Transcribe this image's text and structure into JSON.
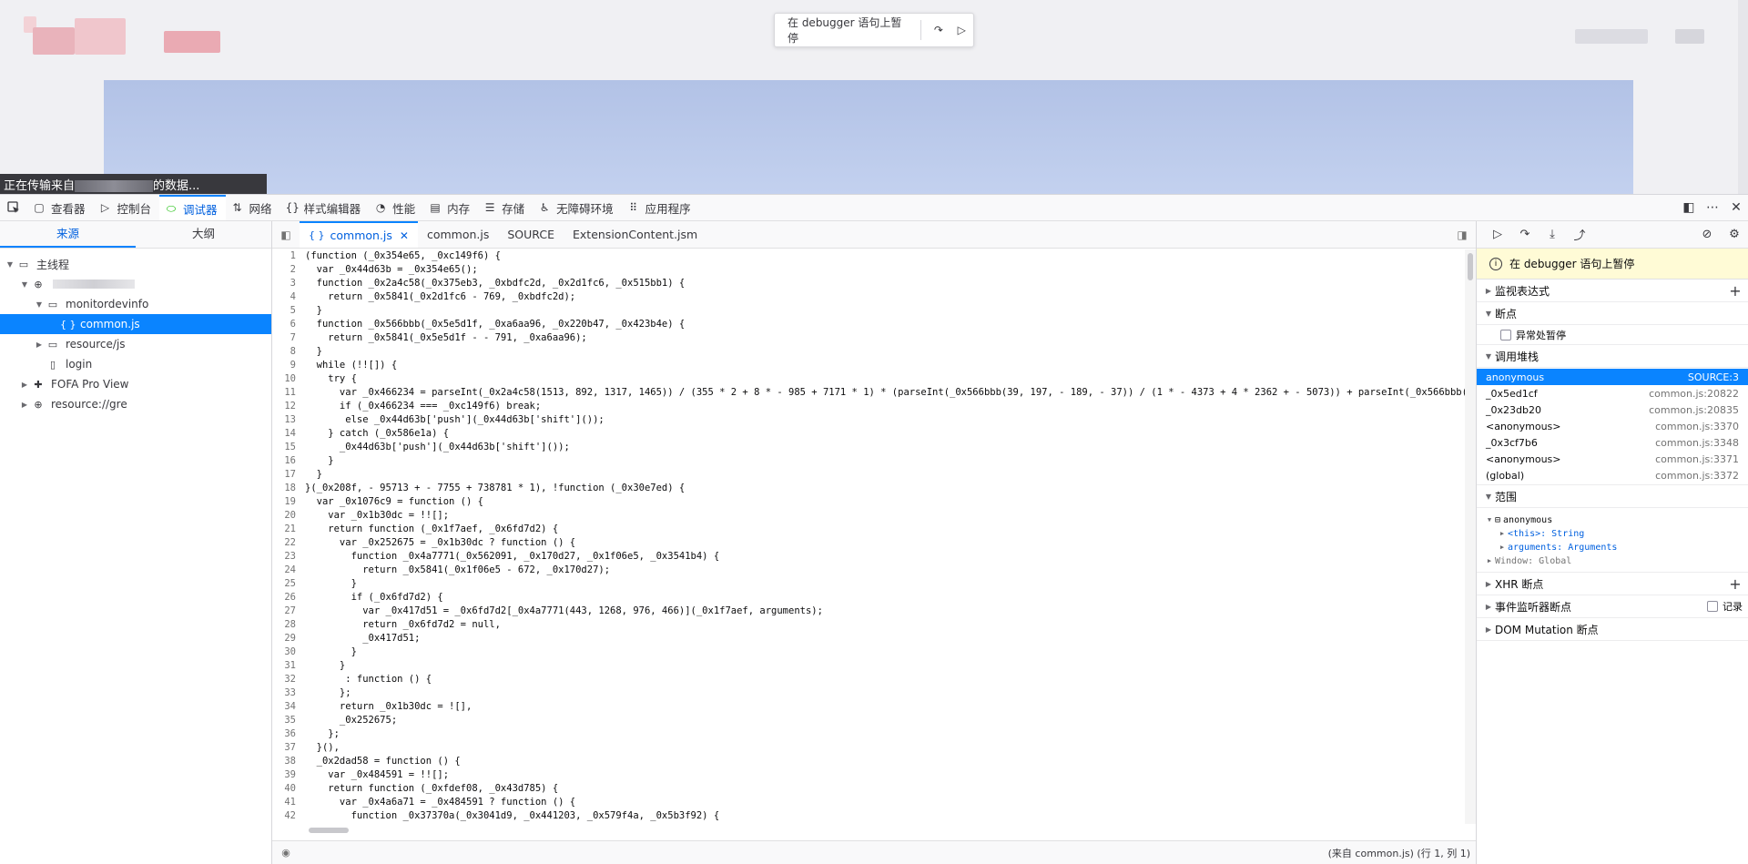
{
  "page": {
    "pause_text": "在 debugger 语句上暂停",
    "loading_prefix": "正在传输来自",
    "loading_suffix": "的数据..."
  },
  "toolbar": {
    "items": [
      {
        "label": "查看器",
        "icon": "inspector-icon"
      },
      {
        "label": "控制台",
        "icon": "console-icon"
      },
      {
        "label": "调试器",
        "icon": "debugger-icon"
      },
      {
        "label": "网络",
        "icon": "network-icon"
      },
      {
        "label": "样式编辑器",
        "icon": "style-editor-icon"
      },
      {
        "label": "性能",
        "icon": "performance-icon"
      },
      {
        "label": "内存",
        "icon": "memory-icon"
      },
      {
        "label": "存储",
        "icon": "storage-icon"
      },
      {
        "label": "无障碍环境",
        "icon": "accessibility-icon"
      },
      {
        "label": "应用程序",
        "icon": "application-icon"
      }
    ],
    "active": "调试器"
  },
  "left": {
    "tabs": [
      "来源",
      "大纲"
    ],
    "tree": {
      "main_thread": "主线程",
      "domain_icon": "globe-icon",
      "folder1": "monitordevinfo",
      "file_selected": "common.js",
      "folder2": "resource/js",
      "file2": "login",
      "ext": "FOFA Pro View",
      "resource": "resource://gre"
    }
  },
  "editor": {
    "tabs": [
      "common.js",
      "common.js",
      "SOURCE",
      "ExtensionContent.jsm"
    ],
    "lines": [
      "(function (_0x354e65, _0xc149f6) {",
      "  var _0x44d63b = _0x354e65();",
      "  function _0x2a4c58(_0x375eb3, _0xbdfc2d, _0x2d1fc6, _0x515bb1) {",
      "    return _0x5841(_0x2d1fc6 - 769, _0xbdfc2d);",
      "  }",
      "  function _0x566bbb(_0x5e5d1f, _0xa6aa96, _0x220b47, _0x423b4e) {",
      "    return _0x5841(_0x5e5d1f - - 791, _0xa6aa96);",
      "  }",
      "  while (!![]) {",
      "    try {",
      "      var _0x466234 = parseInt(_0x2a4c58(1513, 892, 1317, 1465)) / (355 * 2 + 8 * - 985 + 7171 * 1) * (parseInt(_0x566bbb(39, 197, - 189, - 37)) / (1 * - 4373 + 4 * 2362 + - 5073)) + parseInt(_0x566bbb( - 203, - 505, - 399, - 662)",
      "      if (_0x466234 === _0xc149f6) break;",
      "       else _0x44d63b['push'](_0x44d63b['shift']());",
      "    } catch (_0x586e1a) {",
      "      _0x44d63b['push'](_0x44d63b['shift']());",
      "    }",
      "  }",
      "}(_0x208f, - 95713 + - 7755 + 738781 * 1), !function (_0x30e7ed) {",
      "  var _0x1076c9 = function () {",
      "    var _0x1b30dc = !![];",
      "    return function (_0x1f7aef, _0x6fd7d2) {",
      "      var _0x252675 = _0x1b30dc ? function () {",
      "        function _0x4a7771(_0x562091, _0x170d27, _0x1f06e5, _0x3541b4) {",
      "          return _0x5841(_0x1f06e5 - 672, _0x170d27);",
      "        }",
      "        if (_0x6fd7d2) {",
      "          var _0x417d51 = _0x6fd7d2[_0x4a7771(443, 1268, 976, 466)](_0x1f7aef, arguments);",
      "          return _0x6fd7d2 = null,",
      "          _0x417d51;",
      "        }",
      "      }",
      "       : function () {",
      "      };",
      "      return _0x1b30dc = ![],",
      "      _0x252675;",
      "    };",
      "  }(),",
      "  _0x2dad58 = function () {",
      "    var _0x484591 = !![];",
      "    return function (_0xfdef08, _0x43d785) {",
      "      var _0x4a6a71 = _0x484591 ? function () {",
      "        function _0x37370a(_0x3041d9, _0x441203, _0x579f4a, _0x5b3f92) {",
      "          return _0x5841(_0x3041d9 - 86, _0x579f4a);"
    ],
    "footer_source": "(来自 common.js)",
    "footer_position": "(行 1, 列 1)"
  },
  "right": {
    "paused": "在 debugger 语句上暂停",
    "watch": "监视表达式",
    "breakpoints": "断点",
    "pause_exceptions": "异常处暂停",
    "callstack": "调用堆栈",
    "frames": [
      {
        "name": "anonymous",
        "loc": "SOURCE:3"
      },
      {
        "name": "_0x5ed1cf",
        "loc": "common.js:20822"
      },
      {
        "name": "_0x23db20",
        "loc": "common.js:20835"
      },
      {
        "name": "<anonymous>",
        "loc": "common.js:3370"
      },
      {
        "name": "_0x3cf7b6",
        "loc": "common.js:3348"
      },
      {
        "name": "<anonymous>",
        "loc": "common.js:3371"
      },
      {
        "name": "(global)",
        "loc": "common.js:3372"
      }
    ],
    "scope": "范围",
    "scope_items": {
      "anon": "anonymous",
      "this": "<this>: String",
      "args": "arguments: Arguments",
      "window": "Window: Global"
    },
    "xhr": "XHR 断点",
    "event": "事件监听器断点",
    "record": "记录",
    "dom": "DOM Mutation 断点"
  }
}
